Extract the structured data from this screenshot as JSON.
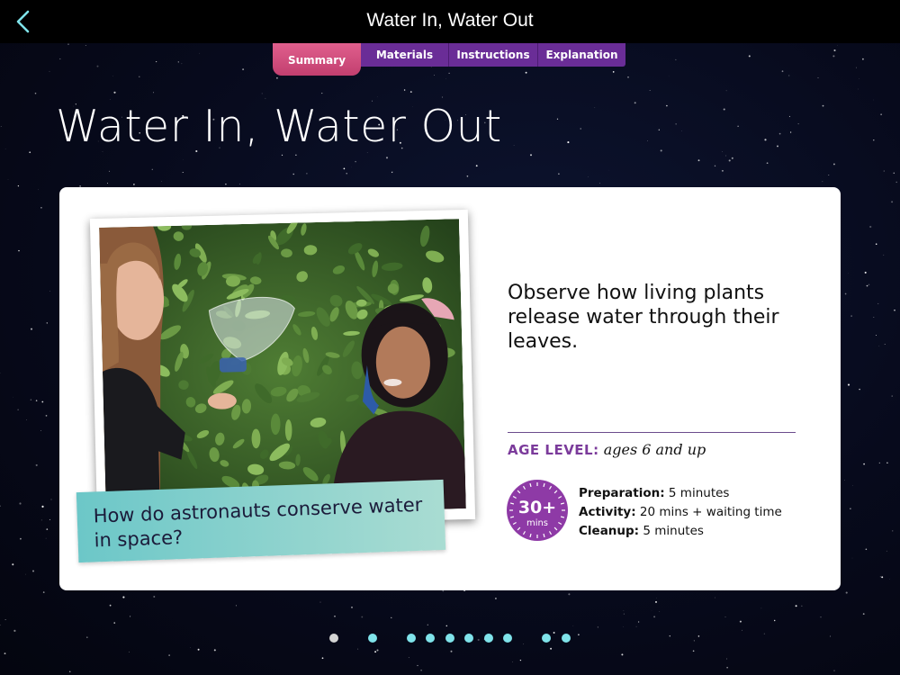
{
  "header": {
    "title": "Water In, Water Out",
    "back_icon": "chevron-left-icon",
    "accent_color": "#7fe3ea"
  },
  "tabs": [
    {
      "label": "Summary",
      "active": true
    },
    {
      "label": "Materials",
      "active": false
    },
    {
      "label": "Instructions",
      "active": false
    },
    {
      "label": "Explanation",
      "active": false
    }
  ],
  "page_title": "Water In, Water Out",
  "card": {
    "photo_caption": "How do astronauts conserve water in space?",
    "summary": "Observe how living plants release water through their leaves.",
    "age_label": "AGE LEVEL:",
    "age_value": "ages 6 and up",
    "time_badge": {
      "value": "30+",
      "unit": "mins"
    },
    "times": [
      {
        "label": "Preparation:",
        "value": "5 minutes"
      },
      {
        "label": "Activity:",
        "value": "20 mins + waiting time"
      },
      {
        "label": "Cleanup:",
        "value": "5 minutes"
      }
    ]
  },
  "pager": {
    "count": 12,
    "current_index": 0
  },
  "colors": {
    "tab_active": "#d34b7d",
    "tab_inactive": "#6a2d97",
    "age_label": "#7b3b9b",
    "badge": "#8e3aa6",
    "caption_bg": "#8fd3cc"
  }
}
